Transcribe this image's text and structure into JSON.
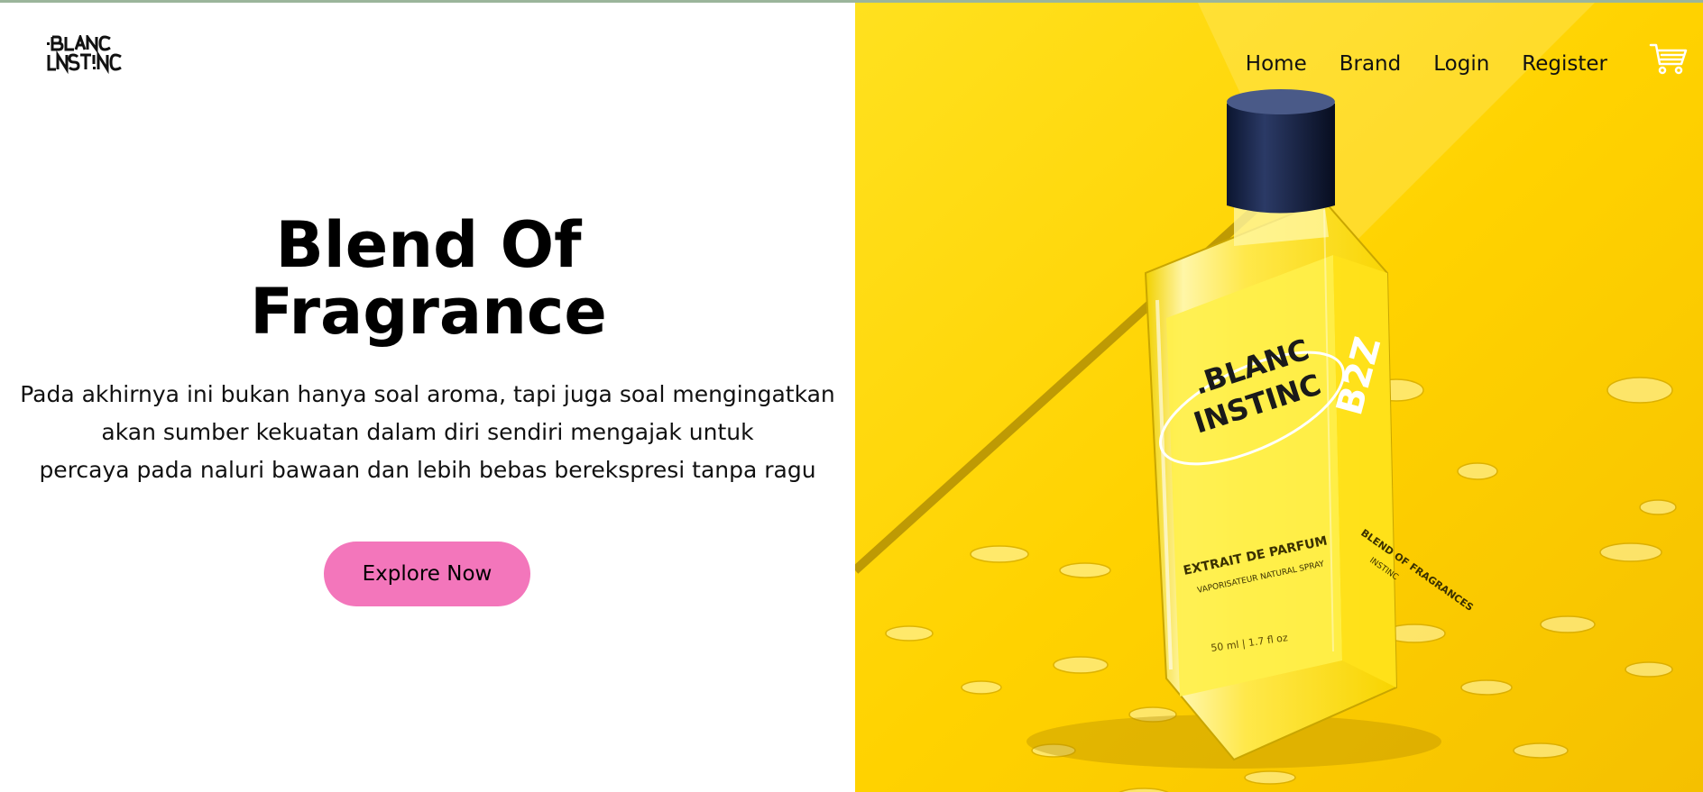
{
  "brand": {
    "logo_line1": ".BLANC",
    "logo_line2": "INSTINC"
  },
  "nav": {
    "items": [
      {
        "label": "Home"
      },
      {
        "label": "Brand"
      },
      {
        "label": "Login"
      },
      {
        "label": "Register"
      }
    ],
    "cart_icon": "shopping-cart-icon"
  },
  "hero": {
    "title_line1": "Blend Of",
    "title_line2": "Fragrance",
    "description": [
      "Pada akhirnya ini bukan hanya soal aroma, tapi juga soal mengingatkan",
      "akan sumber kekuatan dalam diri sendiri mengajak untuk",
      "percaya pada naluri bawaan dan lebih bebas berekspresi tanpa ragu"
    ],
    "cta_label": "Explore Now"
  },
  "product_image": {
    "label_brand_1": ".BLANC",
    "label_brand_2": "INSTINC",
    "label_type": "EXTRAIT DE PARFUM",
    "label_sub": "VAPORISATEUR NATURAL SPRAY",
    "label_volume": "50 ml  |  1.7 fl oz",
    "side_text": "BLEND OF FRAGRANCES",
    "side_sub": "INSTINC",
    "side_code": "B2Z"
  },
  "colors": {
    "cta_bg": "#f376bb",
    "panel_yellow": "#ffd400",
    "text": "#000000"
  }
}
